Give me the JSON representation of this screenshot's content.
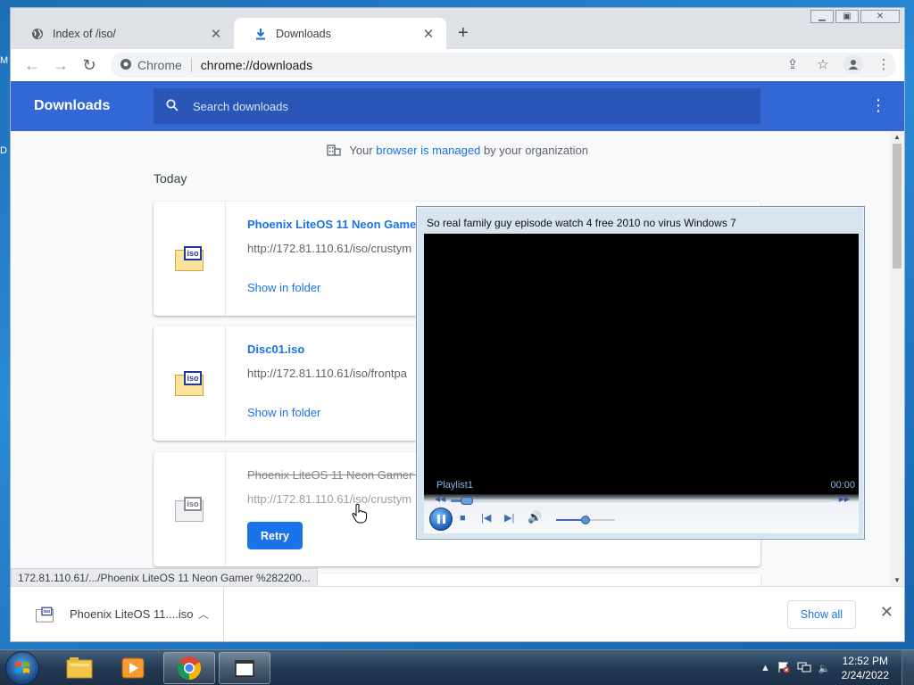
{
  "desktop": {
    "letters": [
      "M",
      "D"
    ]
  },
  "chrome": {
    "tabs": [
      {
        "label": "Index of /iso/",
        "icon": "globe-icon",
        "active": false
      },
      {
        "label": "Downloads",
        "icon": "download-icon",
        "active": true
      }
    ],
    "window_controls": [
      "minimize",
      "maximize",
      "close"
    ],
    "omnibox": {
      "site_name": "Chrome",
      "url_scheme": "chrome://",
      "url_rest": "downloads"
    }
  },
  "downloads": {
    "title": "Downloads",
    "search_placeholder": "Search downloads",
    "managed_prefix": "Your",
    "managed_link": "browser is managed",
    "managed_suffix": "by your organization",
    "section": "Today",
    "items": [
      {
        "name": "Phoenix LiteOS 11 Neon Gamer (",
        "url": "http://172.81.110.61/iso/crustym",
        "action": "Show in folder",
        "state": "complete"
      },
      {
        "name": "Disc01.iso",
        "url": "http://172.81.110.61/iso/frontpa",
        "action": "Show in folder",
        "state": "complete"
      },
      {
        "name": "Phoenix LiteOS 11 Neon Gamer (",
        "url": "http://172.81.110.61/iso/crustym",
        "action": "Retry",
        "state": "failed"
      }
    ],
    "status_url": "172.81.110.61/.../Phoenix LiteOS 11 Neon Gamer %282200..."
  },
  "shelf": {
    "item_name": "Phoenix LiteOS 11....iso",
    "show_all": "Show all"
  },
  "player": {
    "title": "So real family guy episode watch 4 free 2010 no virus Windows 7",
    "playlist": "Playlist1",
    "time": "00:00",
    "seek_progress": 0.03,
    "volume_level": 0.5
  },
  "taskbar": {
    "apps": [
      "explorer",
      "media-player",
      "chrome",
      "file-window"
    ],
    "time": "12:52 PM",
    "date": "2/24/2022"
  },
  "colors": {
    "accent": "#3367d6",
    "link": "#1a73e8",
    "taskbar": "#243a52"
  }
}
